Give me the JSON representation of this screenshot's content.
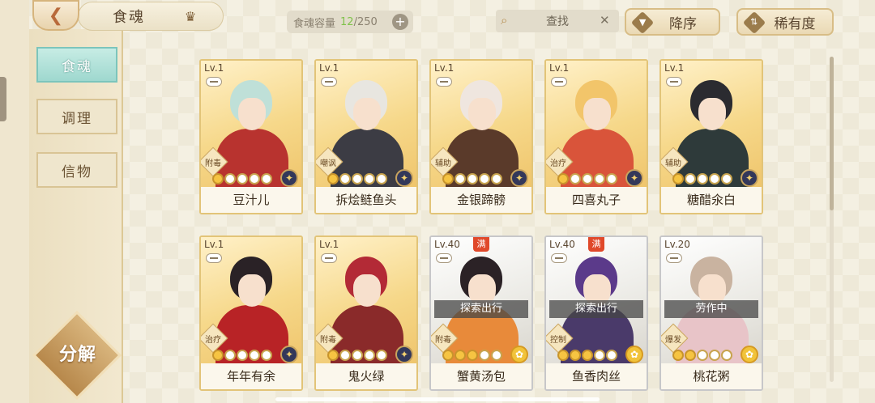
{
  "header": {
    "tab_title": "食魂",
    "capacity": {
      "label": "食魂容量",
      "current": "12",
      "max": "/250"
    },
    "search_placeholder": "查找",
    "sort_order_label": "降序",
    "sort_rarity_label": "稀有度"
  },
  "sidebar": {
    "items": [
      {
        "label": "食魂"
      },
      {
        "label": "调理"
      },
      {
        "label": "信物"
      }
    ],
    "decompose_label": "分解"
  },
  "cards": [
    {
      "level": "Lv.1",
      "name": "豆汁儿",
      "role": "附毒",
      "stars_on": 1,
      "element": "moon",
      "frame": "gold",
      "status": "",
      "full": false,
      "hair": "#bfe0d8",
      "outfit": "#b8332f"
    },
    {
      "level": "Lv.1",
      "name": "拆烩鲢鱼头",
      "role": "嘲讽",
      "stars_on": 1,
      "element": "moon",
      "frame": "gold",
      "status": "",
      "full": false,
      "hair": "#e8e6e0",
      "outfit": "#3c3c44"
    },
    {
      "level": "Lv.1",
      "name": "金银蹄髈",
      "role": "辅助",
      "stars_on": 1,
      "element": "moon",
      "frame": "gold",
      "status": "",
      "full": false,
      "hair": "#efe6df",
      "outfit": "#5a3a2a"
    },
    {
      "level": "Lv.1",
      "name": "四喜丸子",
      "role": "治疗",
      "stars_on": 1,
      "element": "moon",
      "frame": "gold",
      "status": "",
      "full": false,
      "hair": "#f2c56a",
      "outfit": "#d9543a"
    },
    {
      "level": "Lv.1",
      "name": "糖醋氽白",
      "role": "辅助",
      "stars_on": 1,
      "element": "moon",
      "frame": "gold",
      "status": "",
      "full": false,
      "hair": "#2b2b30",
      "outfit": "#2e3a3a"
    },
    {
      "level": "Lv.1",
      "name": "年年有余",
      "role": "治疗",
      "stars_on": 1,
      "element": "moon",
      "frame": "gold",
      "status": "",
      "full": false,
      "hair": "#2a2226",
      "outfit": "#b82326"
    },
    {
      "level": "Lv.1",
      "name": "鬼火绿",
      "role": "附毒",
      "stars_on": 1,
      "element": "moon",
      "frame": "gold",
      "status": "",
      "full": false,
      "hair": "#b32a36",
      "outfit": "#8a2a2a"
    },
    {
      "level": "Lv.40",
      "name": "蟹黄汤包",
      "role": "附毒",
      "stars_on": 3,
      "element": "sun",
      "frame": "silver",
      "status": "探索出行",
      "full": true,
      "hair": "#2b2226",
      "outfit": "#e88a3a"
    },
    {
      "level": "Lv.40",
      "name": "鱼香肉丝",
      "role": "控制",
      "stars_on": 3,
      "element": "sun",
      "frame": "silver",
      "status": "探索出行",
      "full": true,
      "hair": "#5b3a8a",
      "outfit": "#4a3a6a"
    },
    {
      "level": "Lv.20",
      "name": "桃花粥",
      "role": "爆发",
      "stars_on": 2,
      "element": "sun",
      "frame": "silver",
      "status": "劳作中",
      "full": false,
      "hair": "#c9b3a0",
      "outfit": "#e8c4c8"
    }
  ],
  "full_badge_text": "满",
  "colors": {
    "active_tab": "#9fd8cf",
    "gold_frame": "#e2c478",
    "silver_frame": "#c7c7c9",
    "capacity_current": "#7fc24a"
  },
  "icons": {
    "back": "back-arrow-icon",
    "crown": "crown-icon",
    "search": "magnifier-icon",
    "clear": "close-icon",
    "plus": "plus-icon",
    "sort": "sort-icon"
  }
}
